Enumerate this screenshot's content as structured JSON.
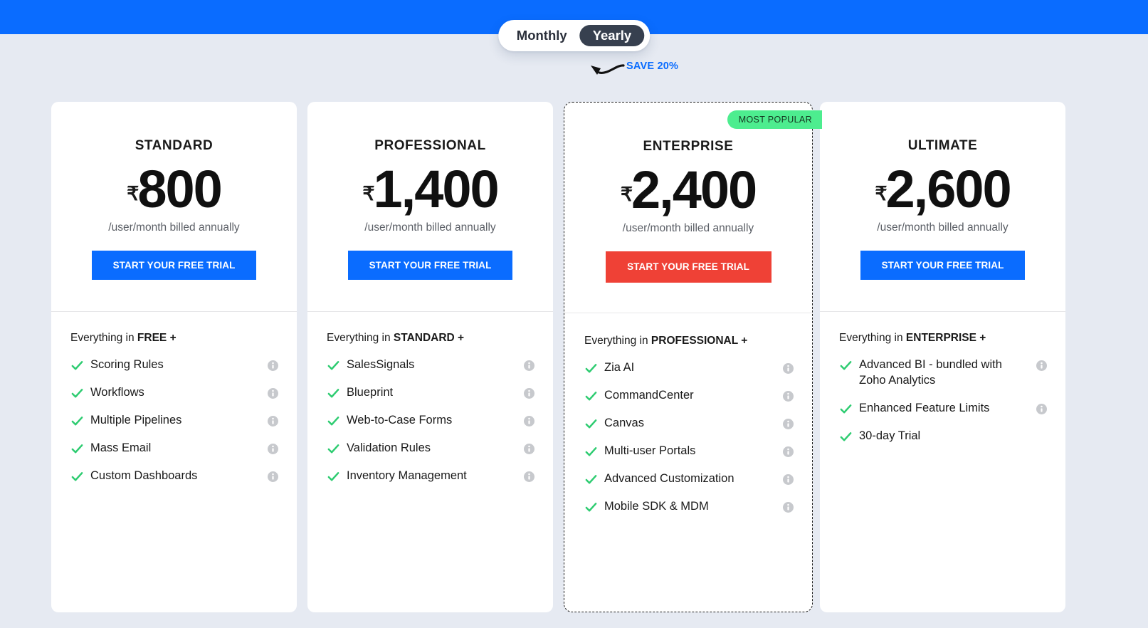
{
  "theme": {
    "band_color": "#0a6cff",
    "page_background": "#e6eaf2",
    "accent_blue": "#0a6cff",
    "accent_red": "#ef4136",
    "badge_green": "#4ded8f",
    "check_green": "#2ecc71",
    "toggle_dark": "#37404f"
  },
  "billing_toggle": {
    "monthly_label": "Monthly",
    "yearly_label": "Yearly",
    "selected": "Yearly",
    "save_note": "SAVE 20%"
  },
  "plans": [
    {
      "name": "STANDARD",
      "currency": "₹",
      "price": "800",
      "billing_note": "/user/month billed annually",
      "cta_label": "START YOUR FREE TRIAL",
      "cta_style": "blue",
      "featured": false,
      "badge": "",
      "everything_prefix": "Everything in ",
      "everything_plan": "FREE",
      "everything_suffix": " +",
      "features": [
        {
          "label": "Scoring Rules",
          "info": true
        },
        {
          "label": "Workflows",
          "info": true
        },
        {
          "label": "Multiple Pipelines",
          "info": true
        },
        {
          "label": "Mass Email",
          "info": true
        },
        {
          "label": "Custom Dashboards",
          "info": true
        }
      ]
    },
    {
      "name": "PROFESSIONAL",
      "currency": "₹",
      "price": "1,400",
      "billing_note": "/user/month billed annually",
      "cta_label": "START YOUR FREE TRIAL",
      "cta_style": "blue",
      "featured": false,
      "badge": "",
      "everything_prefix": "Everything in ",
      "everything_plan": "STANDARD",
      "everything_suffix": " +",
      "features": [
        {
          "label": "SalesSignals",
          "info": true
        },
        {
          "label": "Blueprint",
          "info": true
        },
        {
          "label": "Web-to-Case Forms",
          "info": true
        },
        {
          "label": "Validation Rules",
          "info": true
        },
        {
          "label": "Inventory Management",
          "info": true
        }
      ]
    },
    {
      "name": "ENTERPRISE",
      "currency": "₹",
      "price": "2,400",
      "billing_note": "/user/month billed annually",
      "cta_label": "START YOUR FREE TRIAL",
      "cta_style": "red",
      "featured": true,
      "badge": "MOST POPULAR",
      "everything_prefix": "Everything in ",
      "everything_plan": "PROFESSIONAL",
      "everything_suffix": " +",
      "features": [
        {
          "label": "Zia AI",
          "info": true
        },
        {
          "label": "CommandCenter",
          "info": true
        },
        {
          "label": "Canvas",
          "info": true
        },
        {
          "label": "Multi-user Portals",
          "info": true
        },
        {
          "label": "Advanced Customization",
          "info": true
        },
        {
          "label": "Mobile SDK & MDM",
          "info": true
        }
      ]
    },
    {
      "name": "ULTIMATE",
      "currency": "₹",
      "price": "2,600",
      "billing_note": "/user/month billed annually",
      "cta_label": "START YOUR FREE TRIAL",
      "cta_style": "blue",
      "featured": false,
      "badge": "",
      "everything_prefix": "Everything in ",
      "everything_plan": "ENTERPRISE",
      "everything_suffix": " +",
      "features": [
        {
          "label": "Advanced BI - bundled with Zoho Analytics",
          "info": true
        },
        {
          "label": "Enhanced Feature Limits",
          "info": true
        },
        {
          "label": "30-day Trial",
          "info": false
        }
      ]
    }
  ]
}
